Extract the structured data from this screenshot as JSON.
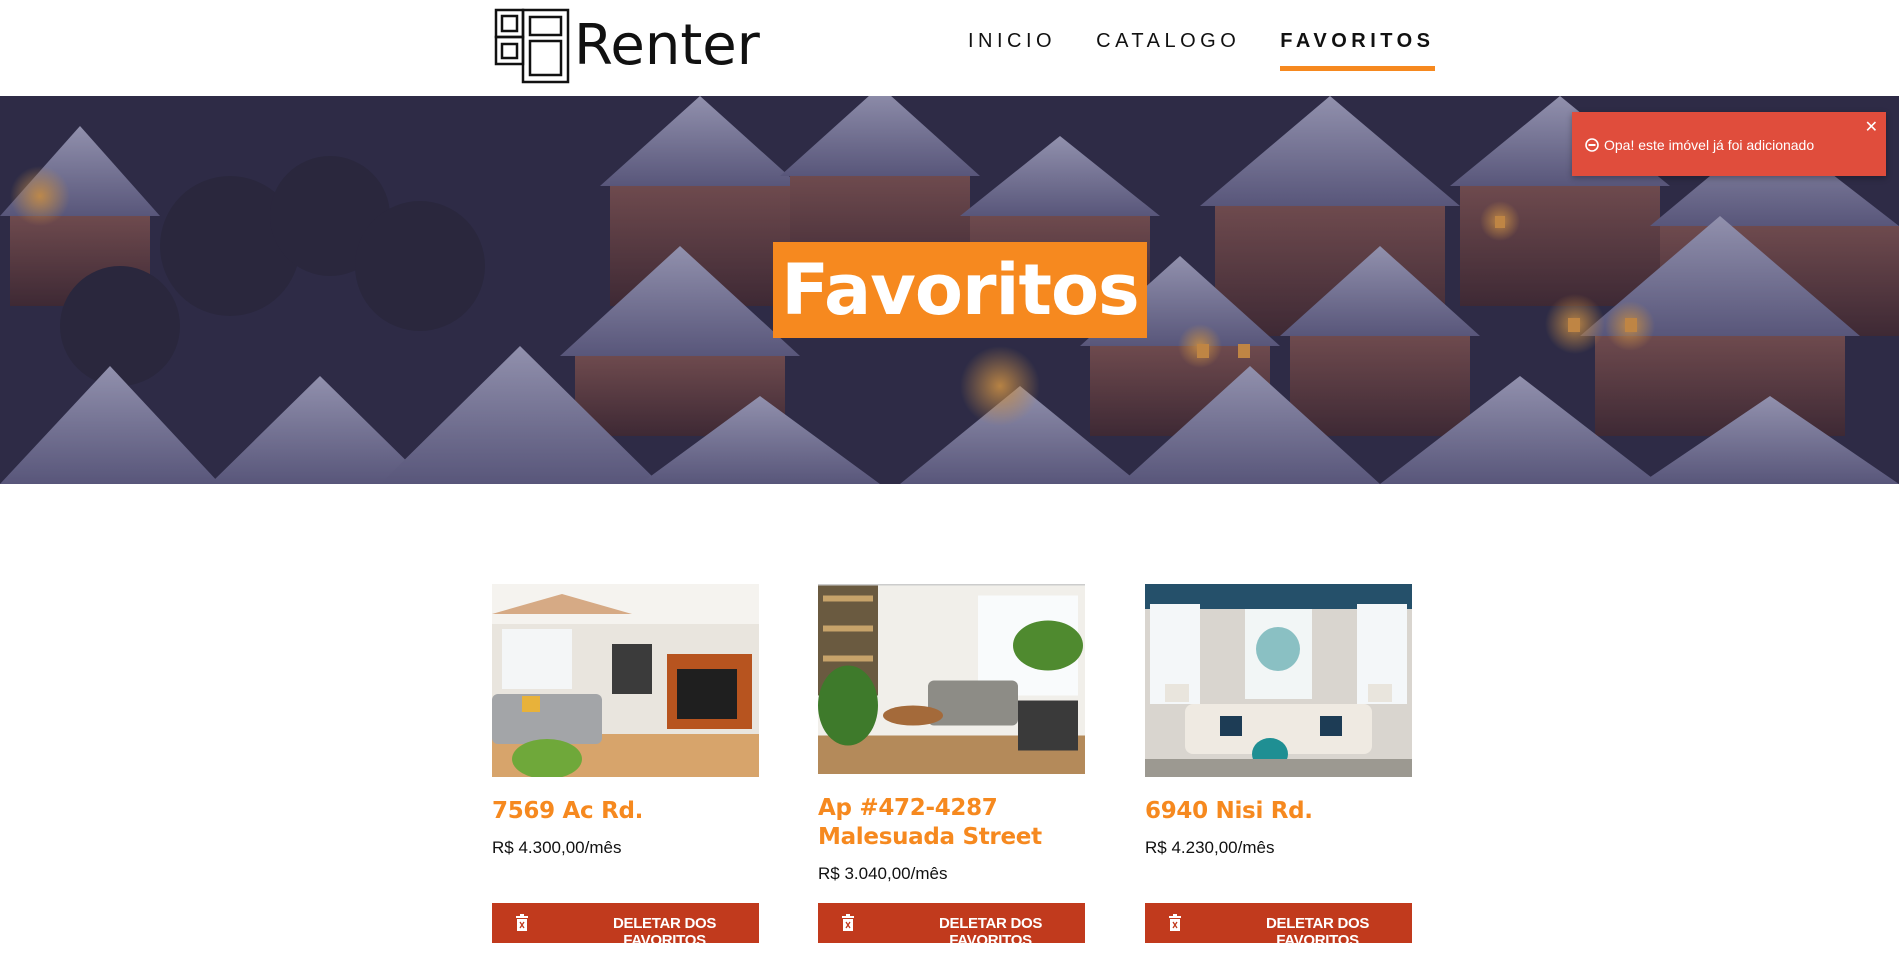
{
  "brand": {
    "name": "Renter",
    "logo_icon": "window-grid-icon"
  },
  "nav": {
    "items": [
      {
        "label": "INICIO",
        "active": false
      },
      {
        "label": "CATALOGO",
        "active": false
      },
      {
        "label": "FAVORITOS",
        "active": true
      }
    ]
  },
  "hero": {
    "title": "Favoritos"
  },
  "toast": {
    "message": "Opa! este imóvel já foi adicionado",
    "icon": "no-entry-icon",
    "close_icon": "close-icon",
    "type": "error"
  },
  "favorites": [
    {
      "title": "7569 Ac Rd.",
      "price": "R$ 4.300,00/mês",
      "button_label": "DELETAR DOS FAVORITOS",
      "photo": "living-room-fireplace"
    },
    {
      "title": "Ap #472-4287 Malesuada Street",
      "price": "R$ 3.040,00/mês",
      "button_label": "DELETAR DOS FAVORITOS",
      "photo": "living-room-plants"
    },
    {
      "title": "6940 Nisi Rd.",
      "price": "R$ 4.230,00/mês",
      "button_label": "DELETAR DOS FAVORITOS",
      "photo": "living-room-sofa-art"
    }
  ],
  "colors": {
    "accent": "#f6891f",
    "delete_button": "#c13a1d",
    "toast_bg": "#e04d3c"
  }
}
